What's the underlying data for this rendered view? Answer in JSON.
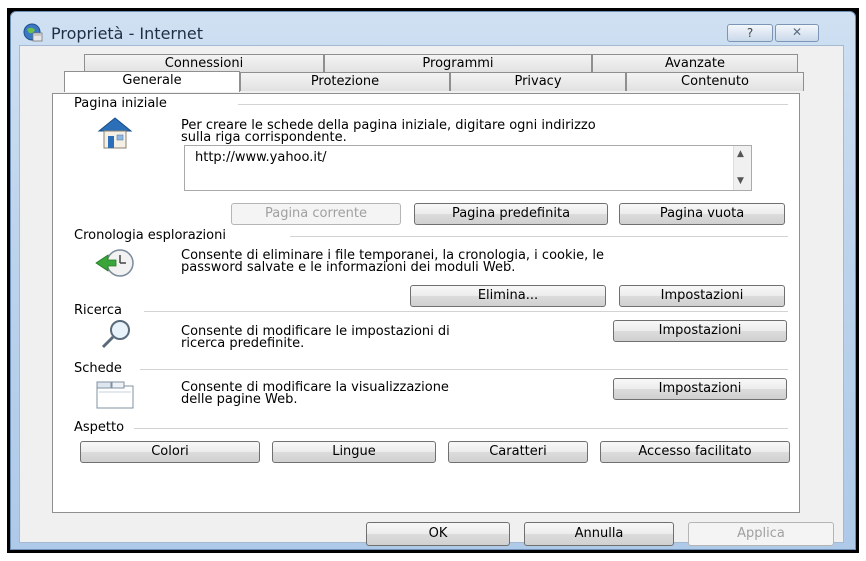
{
  "window": {
    "title": "Proprietà - Internet",
    "help_glyph": "?",
    "close_glyph": "✕"
  },
  "tabs_back": [
    "Connessioni",
    "Programmi",
    "Avanzate"
  ],
  "tabs_front": [
    "Generale",
    "Protezione",
    "Privacy",
    "Contenuto"
  ],
  "home": {
    "group_label": "Pagina iniziale",
    "desc_line1": "Per creare le schede della pagina iniziale, digitare ogni indirizzo",
    "desc_line2": "sulla riga corrispondente.",
    "url": "http://www.yahoo.it/",
    "btn_current": "Pagina corrente",
    "btn_default": "Pagina predefinita",
    "btn_blank": "Pagina vuota"
  },
  "history": {
    "group_label": "Cronologia esplorazioni",
    "desc_line1": "Consente di eliminare i file temporanei, la cronologia, i cookie, le",
    "desc_line2": "password salvate e le informazioni dei moduli Web.",
    "btn_delete": "Elimina...",
    "btn_settings": "Impostazioni"
  },
  "search": {
    "group_label": "Ricerca",
    "desc_line1": "Consente di modificare le impostazioni di",
    "desc_line2": "ricerca predefinite.",
    "btn_settings": "Impostazioni"
  },
  "tabs_section": {
    "group_label": "Schede",
    "desc_line1": "Consente di modificare la visualizzazione",
    "desc_line2": "delle pagine Web.",
    "btn_settings": "Impostazioni"
  },
  "appearance": {
    "group_label": "Aspetto",
    "btn_colors": "Colori",
    "btn_languages": "Lingue",
    "btn_fonts": "Caratteri",
    "btn_accessibility": "Accesso facilitato"
  },
  "footer": {
    "ok": "OK",
    "cancel": "Annulla",
    "apply": "Applica"
  }
}
